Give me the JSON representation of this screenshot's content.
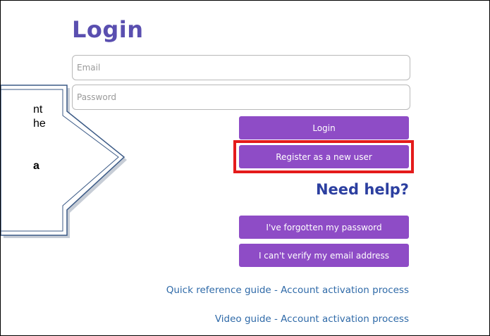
{
  "login": {
    "title": "Login",
    "email_placeholder": "Email",
    "password_placeholder": "Password",
    "login_label": "Login",
    "register_label": "Register as a new user"
  },
  "help": {
    "title": "Need help?",
    "forgot_label": "I've forgotten my password",
    "verify_label": "I can't verify my email address",
    "quick_guide": "Quick reference guide - Account activation process",
    "video_guide": "Video guide - Account activation process"
  },
  "callout": {
    "line1": "nt",
    "line2": "he",
    "line3": "a"
  },
  "colors": {
    "accent_purple": "#8e4cc6",
    "title_purple": "#5a4fb0",
    "help_blue": "#2c3fa0",
    "link_blue": "#2f6aa8",
    "highlight_red": "#e41b1b",
    "callout_border": "#3b5a86"
  }
}
